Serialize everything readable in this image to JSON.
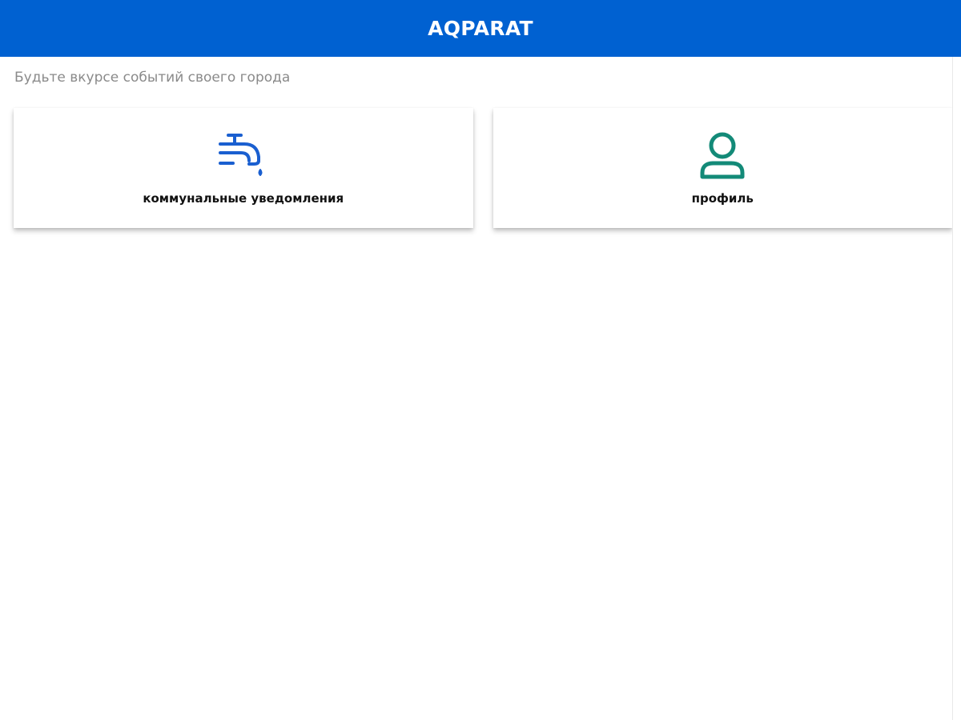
{
  "header": {
    "title": "AQPARAT",
    "background_color": "#0061d1"
  },
  "tagline": "Будьте вкурсе событий своего города",
  "cards": [
    {
      "label": "коммунальные уведомления",
      "icon": "water-tap-icon",
      "icon_color": "#1a5fd0"
    },
    {
      "label": "профиль",
      "icon": "user-profile-icon",
      "icon_color": "#138a78"
    }
  ]
}
